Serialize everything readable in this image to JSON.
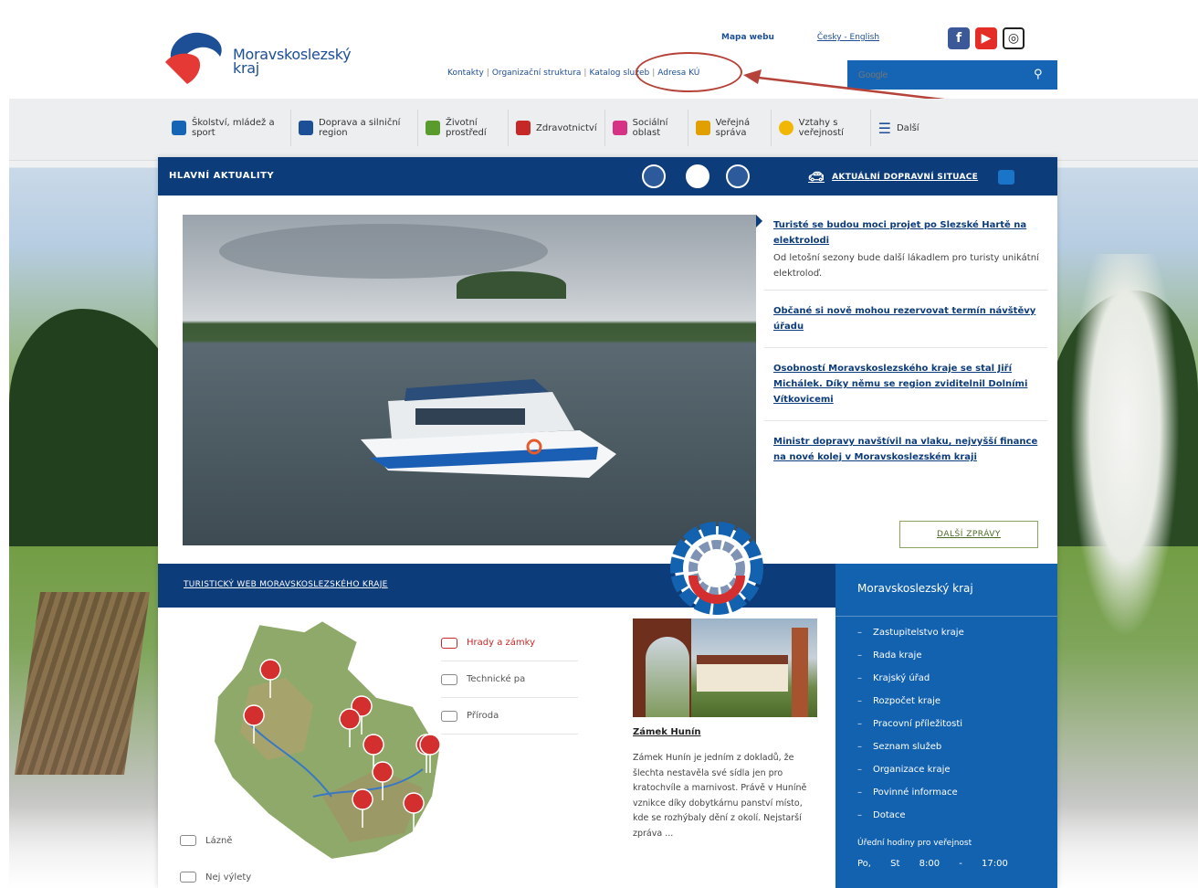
{
  "header": {
    "logo_line1": "Moravskoslezský",
    "logo_line2": "kraj",
    "sitemap": "Mapa webu",
    "lang": "Česky - English",
    "search_placeholder": "Google"
  },
  "secondary_nav": {
    "contacts": "Kontakty",
    "org": "Organizační struktura",
    "catalog": "Katalog služeb",
    "more": "Adresa KÚ"
  },
  "main_nav": [
    {
      "label": "Školství, mládež a sport",
      "icon": "school-icon",
      "color": "#1565b4"
    },
    {
      "label": "Doprava a silniční region",
      "icon": "bus-icon",
      "color": "#1d4f96"
    },
    {
      "label": "Životní prostředí",
      "icon": "tree-icon",
      "color": "#5a9b2e"
    },
    {
      "label": "Zdravotnictví",
      "icon": "health-icon",
      "color": "#c62828"
    },
    {
      "label": "Sociální oblast",
      "icon": "people-icon",
      "color": "#d63384"
    },
    {
      "label": "Veřejná správa",
      "icon": "building-icon",
      "color": "#e0a100"
    },
    {
      "label": "Vztahy s veřejností",
      "icon": "chat-icon",
      "color": "#f2b705"
    },
    {
      "label": "Další",
      "icon": "menu-icon",
      "color": "#1d4f96"
    }
  ],
  "news_bar": {
    "title": "HLAVNÍ AKTUALITY",
    "traffic": "AKTUÁLNÍ DOPRAVNÍ SITUACE"
  },
  "news": [
    {
      "title": "Turisté se budou moci projet po Slezské Hartě na elektrolodi",
      "text": "Od letošní sezony bude další lákadlem pro turisty unikátní elektroloď."
    },
    {
      "title": "Občané si nově mohou rezervovat termín návštěvy úřadu",
      "text": ""
    },
    {
      "title": "Osobností Moravskoslezského kraje se stal Jiří Michálek. Díky němu se region zviditelnil Dolními Vítkovicemi",
      "text": ""
    },
    {
      "title": "Ministr dopravy navštívil na vlaku, nejvyšší finance na nové kolej v Moravskoslezském kraji",
      "text": ""
    }
  ],
  "more_news": "DALŠÍ ZPRÁVY",
  "tourism": {
    "bar_title": "TURISTICKÝ WEB MORAVSKOSLEZSKÉHO KRAJE",
    "categories": [
      "Hrady a zámky",
      "Technické pa",
      "Příroda"
    ],
    "side_categories": [
      "Lázně",
      "Nej výlety"
    ]
  },
  "castle": {
    "title": "Zámek Hunín",
    "text": "Zámek Hunín je jedním z dokladů, že šlechta nestavěla své sídla jen pro kratochvíle a marnivost. Právě v Huníně vznikce díky dobytkárnu panství místo, kde se rozhýbaly dění z okolí. Nejstarší zpráva ..."
  },
  "region": {
    "title": "Moravskoslezský kraj",
    "items": [
      "Zastupitelstvo kraje",
      "Rada kraje",
      "Krajský úřad",
      "Rozpočet kraje",
      "Pracovní příležitosti",
      "Seznam služeb",
      "Organizace kraje",
      "Povinné informace",
      "Dotace"
    ],
    "hours_label": "Úřední hodiny pro veřejnost",
    "hours_day": "Po, St",
    "hours_time": "8:00 - 17:00"
  }
}
